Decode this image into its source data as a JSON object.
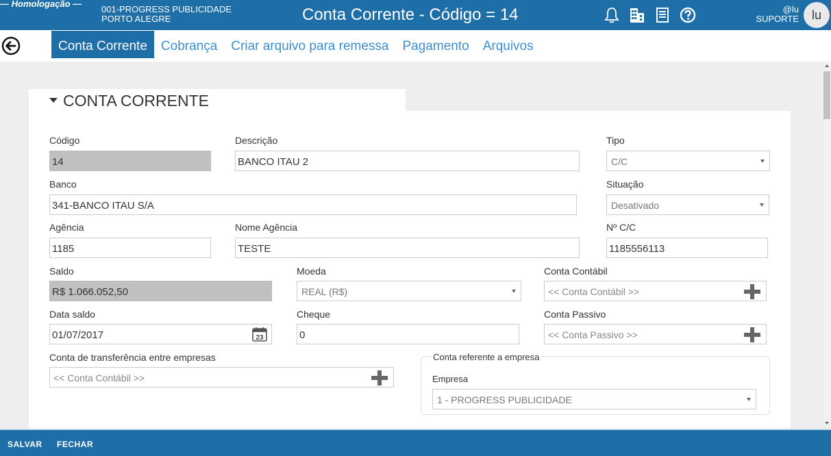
{
  "header": {
    "environment": "— Homologação —",
    "company_line1": "001-PROGRESS PUBLICIDADE",
    "company_line2": "PORTO ALEGRE",
    "title": "Conta Corrente - Código = 14",
    "user_handle": "@lu",
    "user_role": "SUPORTE",
    "avatar_initials": "lu",
    "icons": [
      "bell-icon",
      "building-icon",
      "document-icon",
      "help-icon"
    ]
  },
  "tabs": [
    {
      "label": "Conta Corrente",
      "active": true
    },
    {
      "label": "Cobrança",
      "active": false
    },
    {
      "label": "Criar arquivo para remessa",
      "active": false
    },
    {
      "label": "Pagamento",
      "active": false
    },
    {
      "label": "Arquivos",
      "active": false
    }
  ],
  "section": {
    "title": "CONTA CORRENTE"
  },
  "form": {
    "codigo": {
      "label": "Código",
      "value": "14"
    },
    "descricao": {
      "label": "Descrição",
      "value": "BANCO ITAU 2"
    },
    "tipo": {
      "label": "Tipo",
      "value": "C/C"
    },
    "banco": {
      "label": "Banco",
      "value": "341-BANCO ITAU S/A"
    },
    "situacao": {
      "label": "Situação",
      "value": "Desativado"
    },
    "agencia": {
      "label": "Agência",
      "value": "1185"
    },
    "nome_agencia": {
      "label": "Nome Agência",
      "value": "TESTE"
    },
    "num_cc": {
      "label": "Nº C/C",
      "value": "1185556113"
    },
    "saldo": {
      "label": "Saldo",
      "value": "R$ 1.066.052,50"
    },
    "moeda": {
      "label": "Moeda",
      "value": "REAL (R$)"
    },
    "conta_contabil": {
      "label": "Conta Contábil",
      "placeholder": "<< Conta Contábil >>"
    },
    "data_saldo": {
      "label": "Data saldo",
      "value": "01/07/2017",
      "calendar_day": "23"
    },
    "cheque": {
      "label": "Cheque",
      "value": "0"
    },
    "conta_passivo": {
      "label": "Conta Passivo",
      "placeholder": "<< Conta Passivo >>"
    },
    "conta_transferencia": {
      "label": "Conta de transferência entre empresas",
      "placeholder": "<< Conta Contábil >>"
    },
    "grupo_empresa": {
      "title": "Conta referente a empresa",
      "label": "Empresa",
      "value": "1 - PROGRESS PUBLICIDADE"
    }
  },
  "footer": {
    "save_label": "SALVAR",
    "close_label": "FECHAR"
  },
  "colors": {
    "primary": "#1e6fa8",
    "tab_link": "#3b8ed0",
    "readonly_bg": "#c0c0c0"
  }
}
